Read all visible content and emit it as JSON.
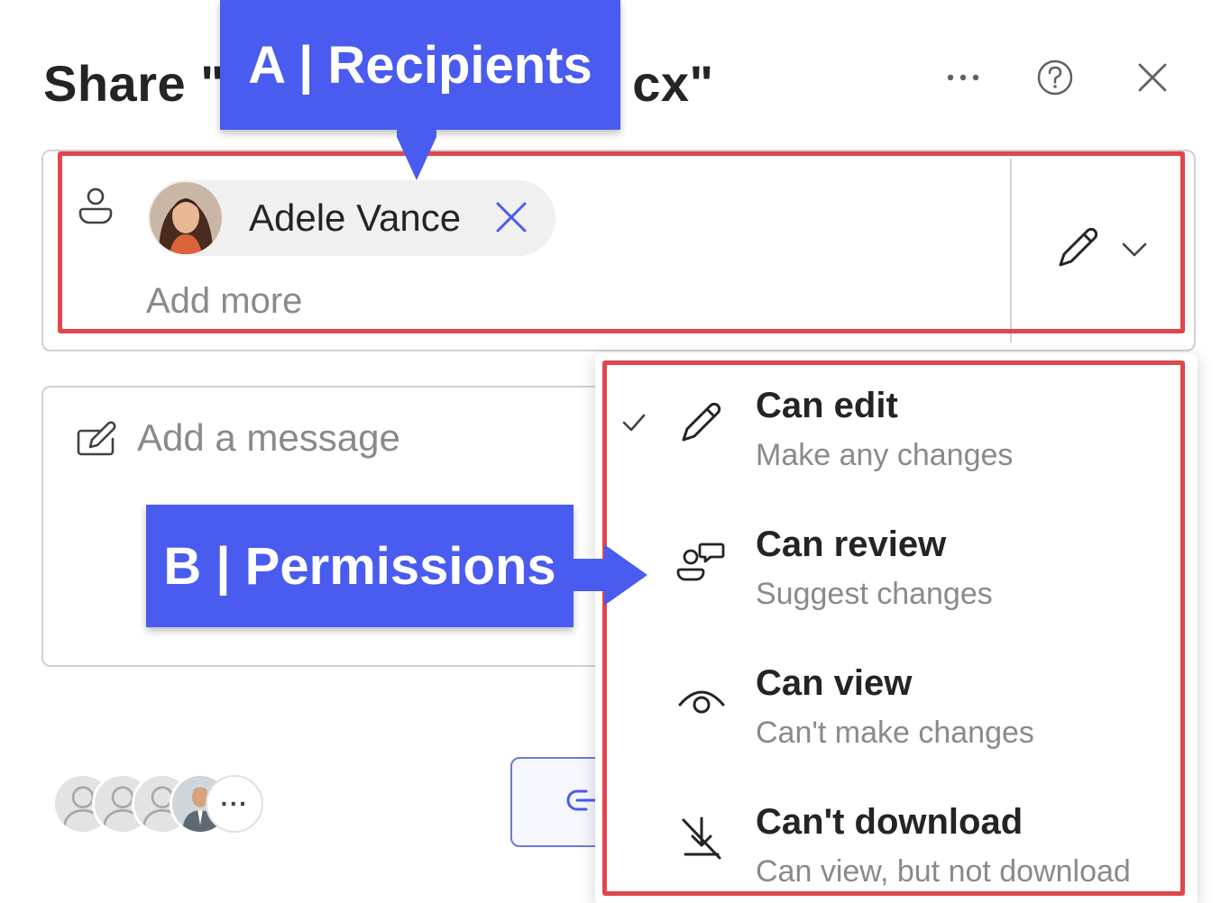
{
  "dialog": {
    "title_prefix": "Share \"",
    "title_suffix": "cx\"",
    "more_label": "···"
  },
  "recipients": {
    "chip_name": "Adele Vance",
    "add_more_placeholder": "Add more"
  },
  "message": {
    "placeholder": "Add a message"
  },
  "facepile": {
    "more_label": "···"
  },
  "permissions_menu": {
    "items": [
      {
        "title": "Can edit",
        "subtitle": "Make any changes",
        "icon": "pencil-icon",
        "checked": true
      },
      {
        "title": "Can review",
        "subtitle": "Suggest changes",
        "icon": "review-icon",
        "checked": false
      },
      {
        "title": "Can view",
        "subtitle": "Can't make changes",
        "icon": "eye-icon",
        "checked": false
      },
      {
        "title": "Can't download",
        "subtitle": "Can view, but not download",
        "icon": "no-download-icon",
        "checked": false
      }
    ]
  },
  "callouts": {
    "a": "A | Recipients",
    "b": "B | Permissions"
  },
  "colors": {
    "callout_blue": "#4a5bef",
    "highlight_red": "#e0474c",
    "accent_blue": "#5b6bd8"
  }
}
